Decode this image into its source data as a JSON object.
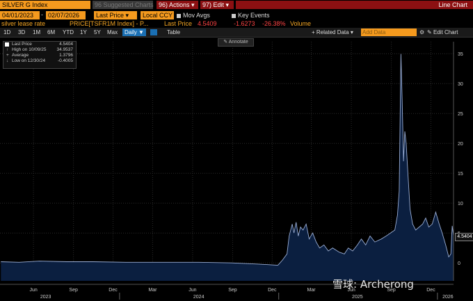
{
  "header": {
    "ticker": "SILVER G Index",
    "suggested_charts": "96 Suggested Charts",
    "actions": "96) Actions",
    "edit": "97) Edit",
    "chart_type": "Line Chart"
  },
  "controls": {
    "start_date": "04/01/2023",
    "end_date": "02/07/2026",
    "field": "Last Price",
    "currency": "Local CCY",
    "mov_avgs": "Mov Avgs",
    "key_events": "Key Events"
  },
  "series_line": {
    "name": "silver lease rate",
    "security": "PRICE[TSFR1M Index] - P...",
    "field": "Last Price",
    "last": "4.5409",
    "change": "-1.6273",
    "pct_change": "-26.38%",
    "volume": "Volume"
  },
  "ranges": [
    "1D",
    "3D",
    "1M",
    "6M",
    "YTD",
    "1Y",
    "5Y",
    "Max"
  ],
  "period": "Daily",
  "table_label": "Table",
  "related_data": "+ Related Data",
  "add_data_placeholder": "Add Data",
  "edit_chart": "Edit Chart",
  "annotate": "Annotate",
  "legend": {
    "last_price_label": "Last Price",
    "last_price_value": "4.5404",
    "high_label": "High on 10/09/25",
    "high_value": "34.9537",
    "average_label": "Average",
    "average_value": "1.3796",
    "low_label": "Low on 12/30/24",
    "low_value": "-0.4005"
  },
  "watermark": "雪球: Archerong",
  "chart_data": {
    "type": "area",
    "title": "",
    "xlabel": "",
    "ylabel": "",
    "ylim": [
      -3,
      37
    ],
    "yticks": [
      0,
      5,
      10,
      15,
      20,
      25,
      30,
      35
    ],
    "x_tick_labels": [
      "Jun",
      "Sep",
      "Dec",
      "Mar",
      "Jun",
      "Sep",
      "Dec",
      "Mar",
      "Jun",
      "Sep",
      "Dec"
    ],
    "year_labels": [
      "2023",
      "2024",
      "2025",
      "2026"
    ],
    "series": [
      {
        "name": "silver lease rate",
        "color": "#9aaed6",
        "fill": "#0b1f40",
        "points": [
          [
            "2023-04-03",
            0.2
          ],
          [
            "2023-05-15",
            0.1
          ],
          [
            "2023-07-01",
            0.3
          ],
          [
            "2023-09-01",
            0.2
          ],
          [
            "2023-11-01",
            0.2
          ],
          [
            "2024-01-15",
            0.1
          ],
          [
            "2024-04-01",
            0.1
          ],
          [
            "2024-07-01",
            0.1
          ],
          [
            "2024-09-15",
            0.0
          ],
          [
            "2024-11-15",
            -0.2
          ],
          [
            "2024-12-30",
            -0.4
          ],
          [
            "2025-01-10",
            0.5
          ],
          [
            "2025-01-20",
            1.5
          ],
          [
            "2025-01-25",
            4.5
          ],
          [
            "2025-02-01",
            6.5
          ],
          [
            "2025-02-05",
            5.0
          ],
          [
            "2025-02-10",
            6.8
          ],
          [
            "2025-02-15",
            4.5
          ],
          [
            "2025-02-20",
            6.0
          ],
          [
            "2025-02-26",
            5.5
          ],
          [
            "2025-03-05",
            6.5
          ],
          [
            "2025-03-12",
            4.0
          ],
          [
            "2025-03-20",
            5.0
          ],
          [
            "2025-03-28",
            3.5
          ],
          [
            "2025-04-05",
            2.5
          ],
          [
            "2025-04-15",
            3.0
          ],
          [
            "2025-04-25",
            2.0
          ],
          [
            "2025-05-05",
            2.5
          ],
          [
            "2025-05-20",
            1.8
          ],
          [
            "2025-06-01",
            1.5
          ],
          [
            "2025-06-10",
            2.5
          ],
          [
            "2025-06-20",
            2.0
          ],
          [
            "2025-07-01",
            3.0
          ],
          [
            "2025-07-10",
            4.0
          ],
          [
            "2025-07-20",
            3.0
          ],
          [
            "2025-07-30",
            4.5
          ],
          [
            "2025-08-10",
            3.5
          ],
          [
            "2025-08-25",
            4.0
          ],
          [
            "2025-09-05",
            4.5
          ],
          [
            "2025-09-15",
            5.0
          ],
          [
            "2025-09-25",
            5.5
          ],
          [
            "2025-10-01",
            8.0
          ],
          [
            "2025-10-05",
            12.0
          ],
          [
            "2025-10-09",
            34.95
          ],
          [
            "2025-10-12",
            27.0
          ],
          [
            "2025-10-15",
            17.0
          ],
          [
            "2025-10-18",
            22.0
          ],
          [
            "2025-10-21",
            20.0
          ],
          [
            "2025-10-25",
            15.0
          ],
          [
            "2025-10-30",
            9.0
          ],
          [
            "2025-11-05",
            6.5
          ],
          [
            "2025-11-12",
            5.5
          ],
          [
            "2025-11-20",
            6.0
          ],
          [
            "2025-11-28",
            6.5
          ],
          [
            "2025-12-05",
            7.5
          ],
          [
            "2025-12-12",
            6.0
          ],
          [
            "2025-12-20",
            6.5
          ],
          [
            "2025-12-28",
            8.5
          ],
          [
            "2026-01-05",
            6.5
          ],
          [
            "2026-01-12",
            5.0
          ],
          [
            "2026-01-20",
            3.0
          ],
          [
            "2026-01-27",
            1.0
          ],
          [
            "2026-02-01",
            1.5
          ],
          [
            "2026-02-04",
            6.2
          ],
          [
            "2026-02-07",
            4.54
          ]
        ]
      }
    ]
  }
}
